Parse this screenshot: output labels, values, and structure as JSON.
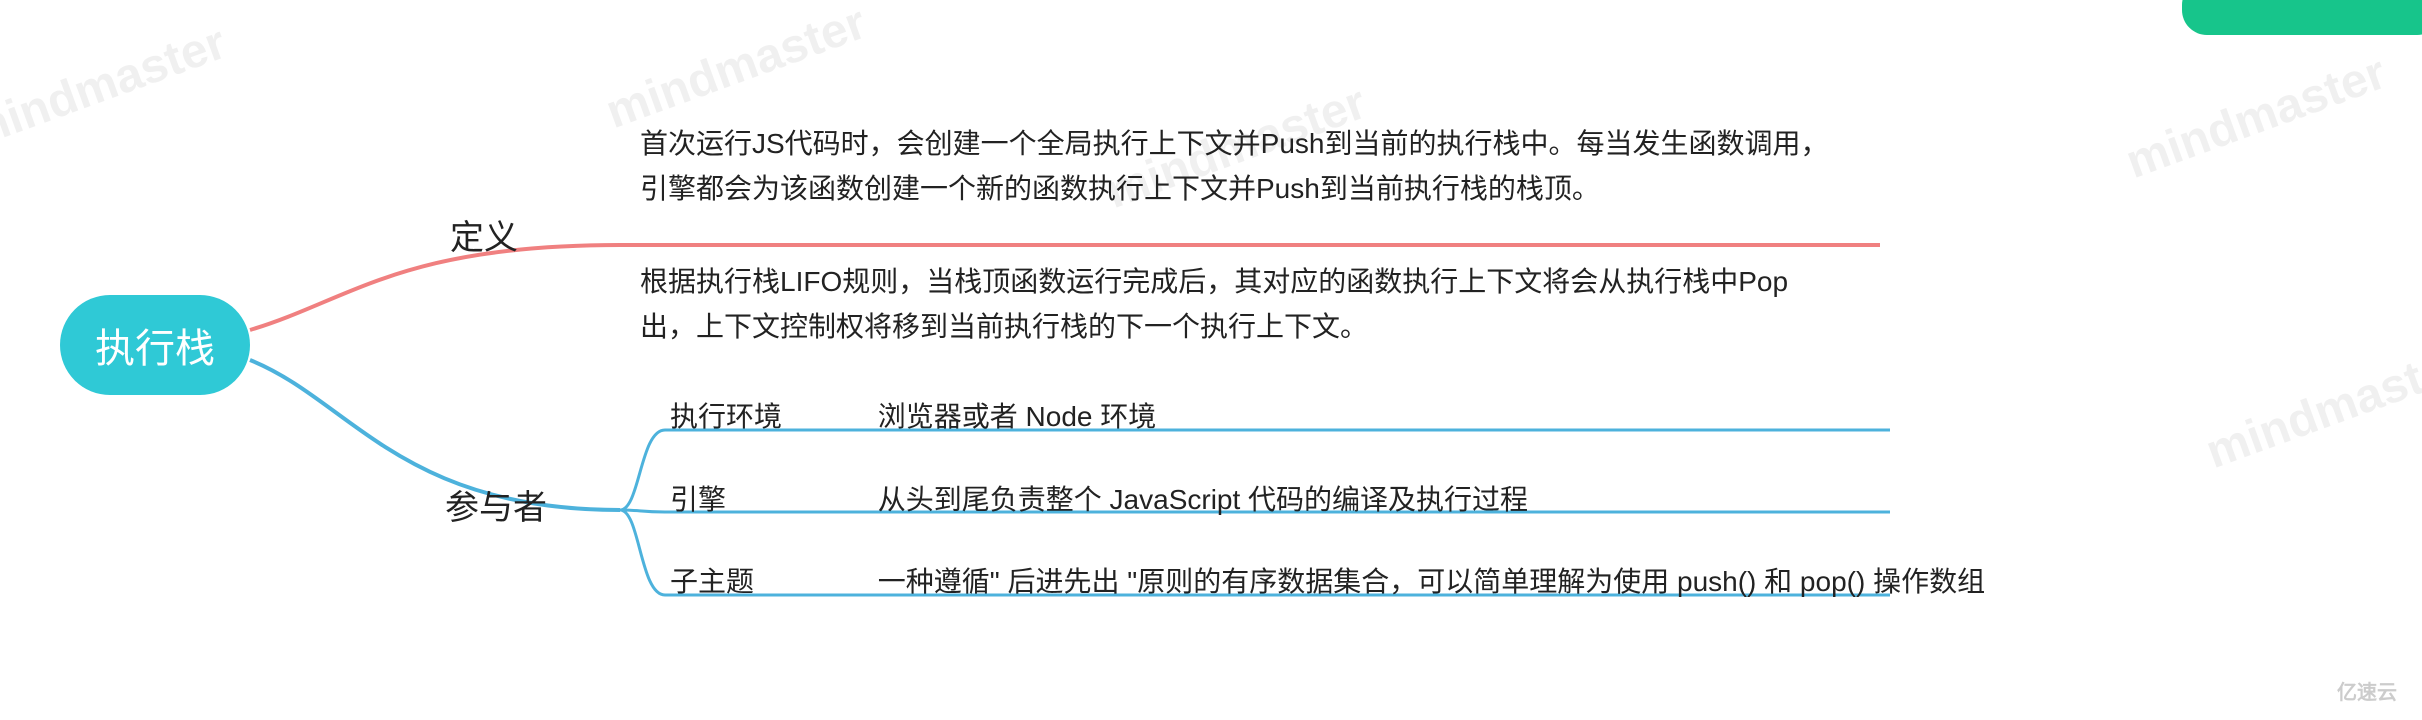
{
  "root": {
    "label": "执行栈"
  },
  "branches": {
    "definition": {
      "label": "定义",
      "lines": [
        "首次运行JS代码时，会创建一个全局执行上下文并Push到当前的执行栈中。每当发生函数调用，引擎都会为该函数创建一个新的函数执行上下文并Push到当前执行栈的栈顶。",
        "根据执行栈LIFO规则，当栈顶函数运行完成后，其对应的函数执行上下文将会从执行栈中Pop出，上下文控制权将移到当前执行栈的下一个执行上下文。"
      ]
    },
    "participants": {
      "label": "参与者",
      "rows": [
        {
          "k": "执行环境",
          "v": "浏览器或者 Node 环境"
        },
        {
          "k": "引擎",
          "v": "从头到尾负责整个 JavaScript 代码的编译及执行过程"
        },
        {
          "k": "子主题",
          "v": "一种遵循\" 后进先出 \"原则的有序数据集合，可以简单理解为使用 push() 和 pop() 操作数组"
        }
      ]
    }
  },
  "colors": {
    "root": "#2fc9d6",
    "red": "#f08080",
    "blue": "#4db2dc",
    "green": "#17c58b"
  },
  "watermark": "mindmaster",
  "footer_logo": "亿速云"
}
